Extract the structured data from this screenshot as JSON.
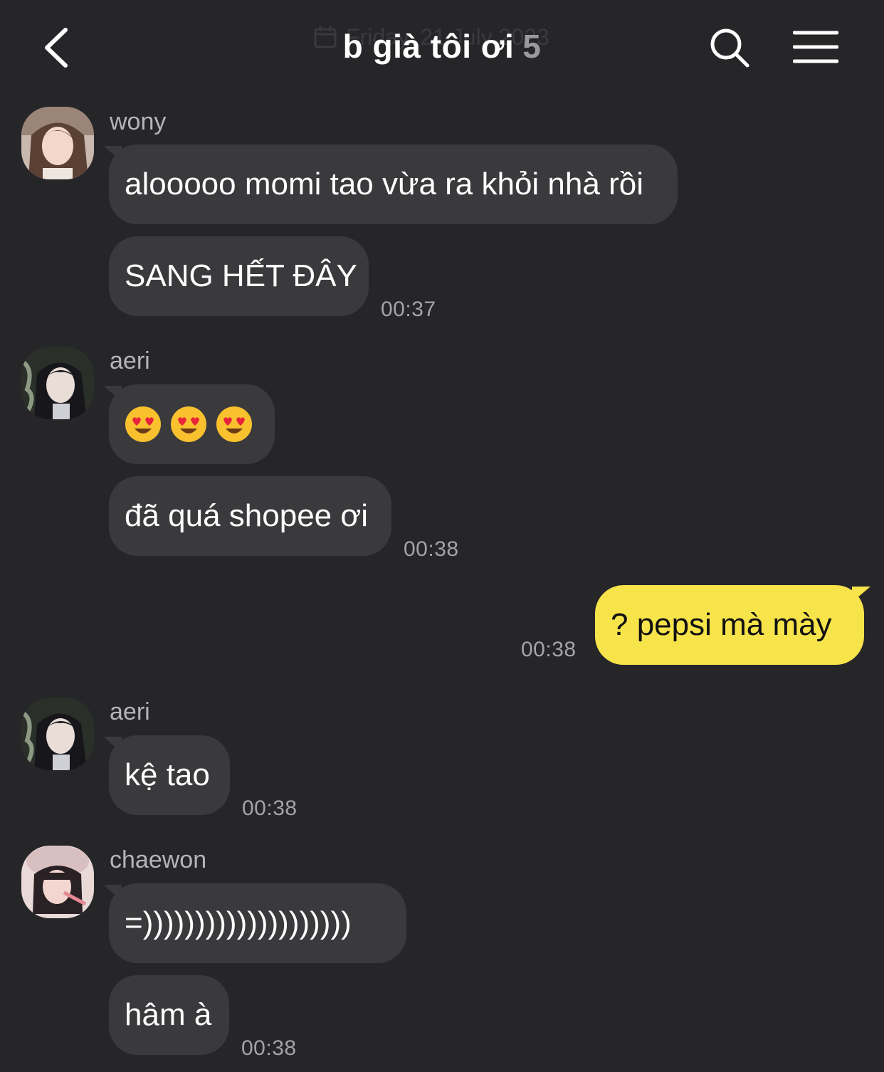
{
  "header": {
    "date_ghost": "Friday, 21 July 2023",
    "title": "b già tôi ơi",
    "member_count": "5"
  },
  "messages": [
    {
      "sender": "wony",
      "bubbles": [
        "alooooo momi tao vừa ra khỏi nhà rồi",
        "SANG HẾT ĐÂY"
      ],
      "time": "00:37"
    },
    {
      "sender": "aeri",
      "bubbles": [
        "😍😍😍",
        "đã quá shopee ơi"
      ],
      "time": "00:38"
    },
    {
      "sender": "me",
      "bubbles": [
        "? pepsi mà mày"
      ],
      "time": "00:38"
    },
    {
      "sender": "aeri",
      "bubbles": [
        "kệ tao"
      ],
      "time": "00:38"
    },
    {
      "sender": "chaewon",
      "bubbles": [
        "=))))))))))))))))))))",
        "hâm à"
      ],
      "time": "00:38"
    }
  ],
  "colors": {
    "background": "#262629",
    "bubble_received": "#3a3a3d",
    "bubble_sent": "#f7e34a"
  },
  "icons": [
    "back-arrow-icon",
    "calendar-icon",
    "search-icon",
    "menu-icon",
    "heart-eyes-emoji"
  ]
}
